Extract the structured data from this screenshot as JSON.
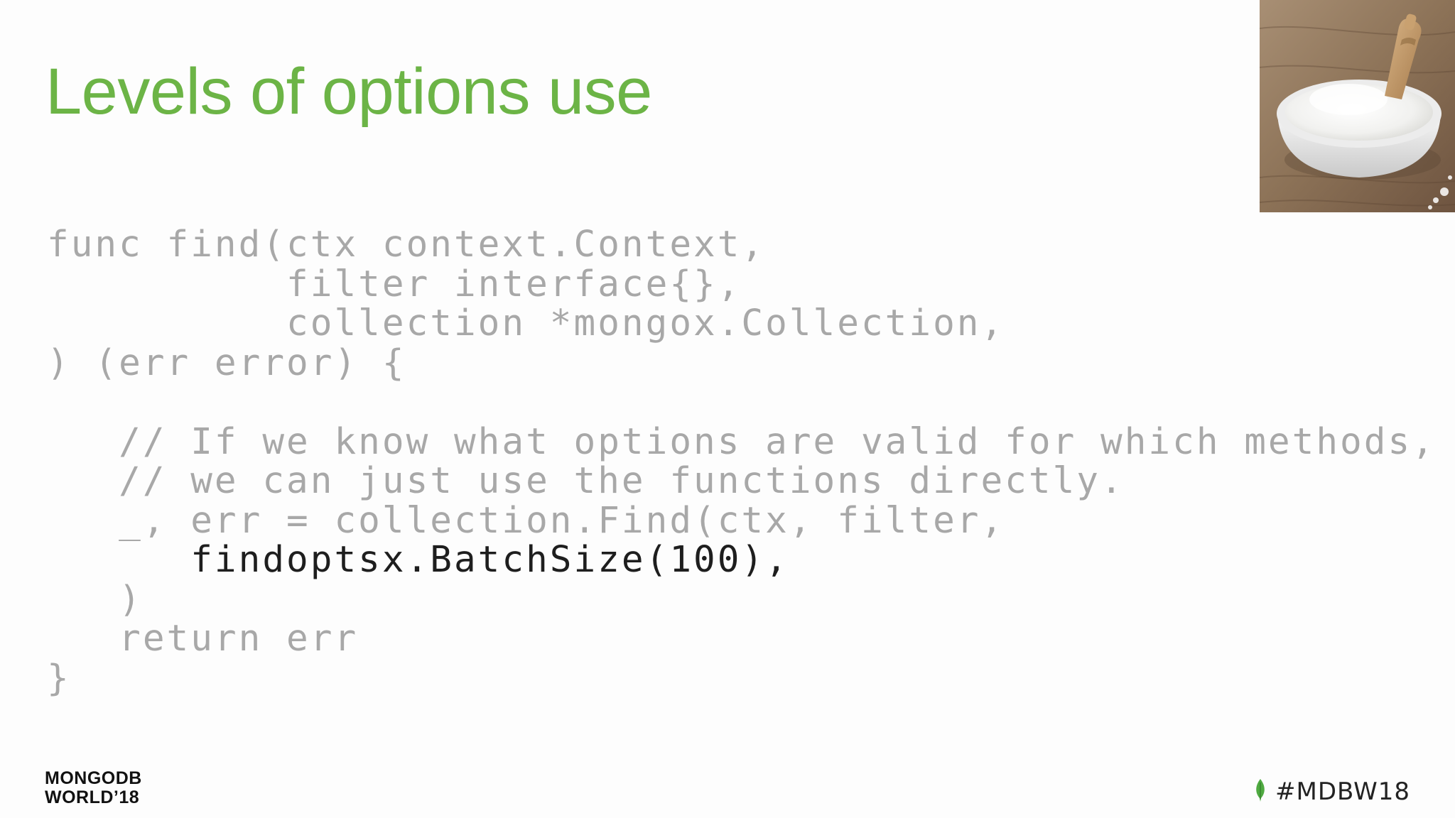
{
  "slide": {
    "title": "Levels of options use",
    "code_lines": [
      "func find(ctx context.Context,",
      "          filter interface{},",
      "          collection *mongox.Collection,",
      ") (err error) {",
      "",
      "   // If we know what options are valid for which methods,",
      "   // we can just use the functions directly.",
      "   _, err = collection.Find(ctx, filter,",
      "      findoptsx.BatchSize(100),",
      "   )",
      "   return err",
      "}"
    ],
    "highlighted_line": "      findoptsx.BatchSize(100),",
    "photo_icon": "baking-soda-bowl-photo"
  },
  "footer": {
    "logo_line1": "MONGODB",
    "logo_line2": "WORLD’18",
    "hashtag": "#MDBW18",
    "leaf_icon": "mongodb-leaf-icon"
  },
  "colors": {
    "title": "#6cb446",
    "code_dim": "#a8a8a8",
    "code_highlight": "#1e1e1e",
    "leaf": "#4faa41"
  }
}
